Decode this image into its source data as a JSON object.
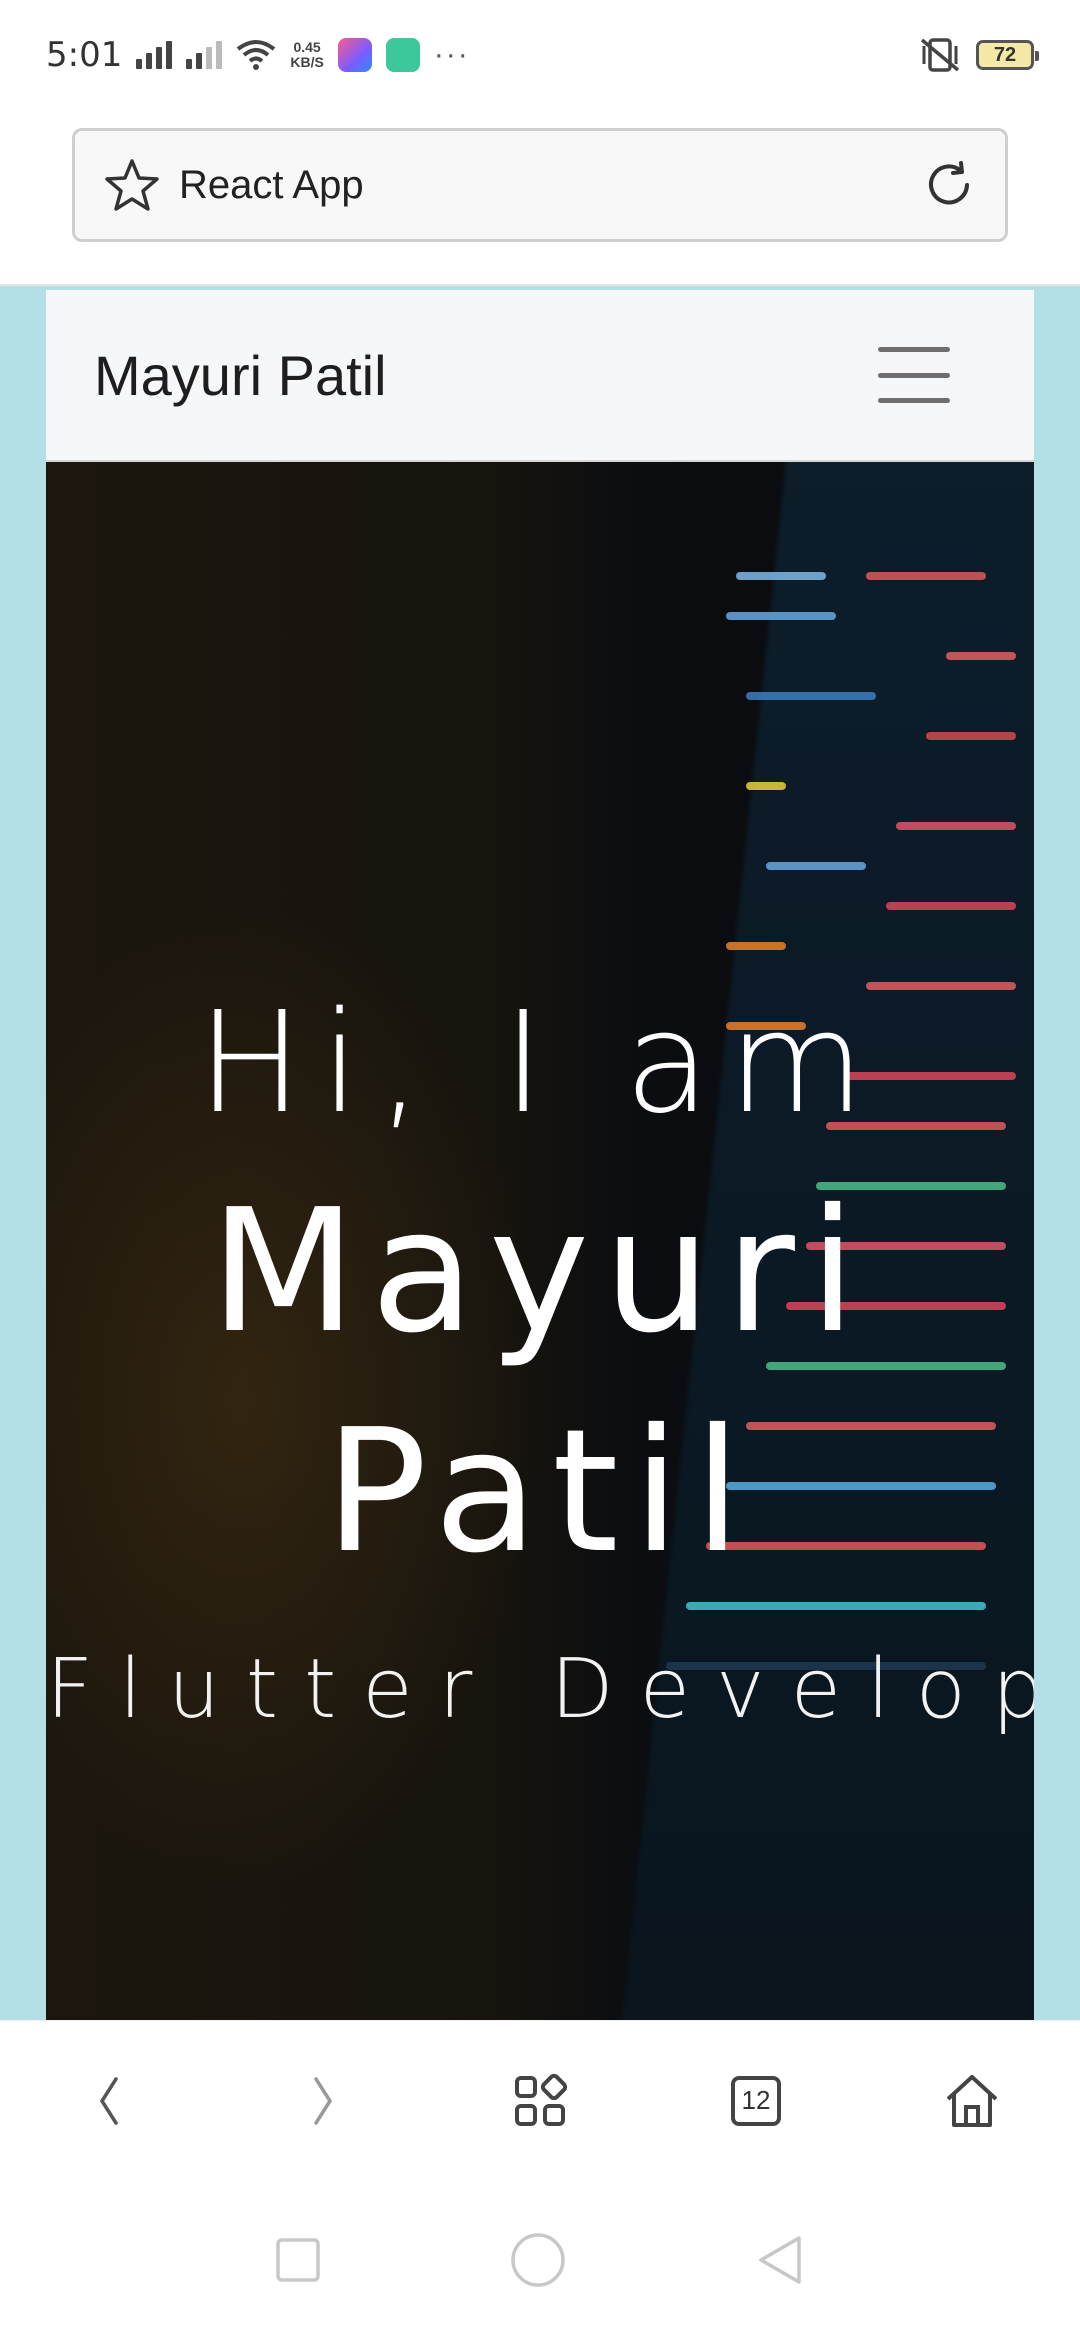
{
  "status_bar": {
    "time": "5:01",
    "speed_value": "0.45",
    "speed_unit": "KB/S",
    "more": "···",
    "battery": "72"
  },
  "browser": {
    "page_title": "React App",
    "tab_count": "12"
  },
  "navbar": {
    "brand": "Mayuri Patil"
  },
  "hero": {
    "greeting": "Hi, I am",
    "name_line1": "Mayuri",
    "name_line2": "Patil",
    "role": "Flutter Develope"
  },
  "colors": {
    "page_background": "#b3e0e6",
    "navbar_background": "#f5f7f9",
    "hero_text": "#ffffff"
  },
  "icons": {
    "bookmark": "star-icon",
    "reload": "reload-icon",
    "menu": "hamburger-icon",
    "back": "back-icon",
    "forward": "forward-icon",
    "apps": "apps-icon",
    "tabs": "tabs-icon",
    "home": "home-icon"
  }
}
